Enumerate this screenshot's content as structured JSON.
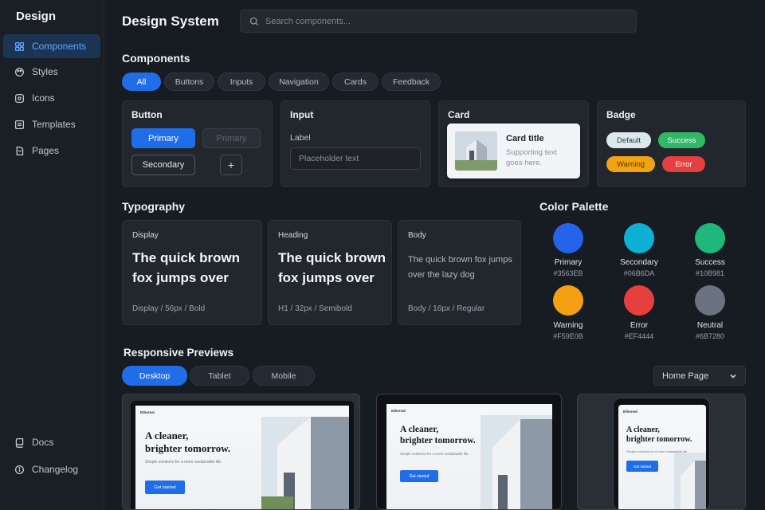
{
  "sidebar": {
    "brand": "Design",
    "items": [
      {
        "label": "Components",
        "icon": "components-icon"
      },
      {
        "label": "Styles",
        "icon": "palette-icon"
      },
      {
        "label": "Icons",
        "icon": "icons-icon"
      },
      {
        "label": "Templates",
        "icon": "templates-icon"
      },
      {
        "label": "Pages",
        "icon": "pages-icon"
      }
    ],
    "footer": [
      {
        "label": "Docs",
        "icon": "docs-icon"
      },
      {
        "label": "Changelog",
        "icon": "info-icon"
      }
    ]
  },
  "header": {
    "title": "Design System",
    "search_placeholder": "Search components..."
  },
  "components": {
    "heading": "Components",
    "filters": [
      "All",
      "Buttons",
      "Inputs",
      "Navigation",
      "Cards",
      "Feedback"
    ],
    "button_card": {
      "title": "Button",
      "primary": "Primary",
      "primary_disabled": "Primary",
      "secondary": "Secondary",
      "icon_button": "+"
    },
    "input_card": {
      "title": "Input",
      "label": "Label",
      "placeholder": "Placeholder text"
    },
    "card_card": {
      "title": "Card",
      "card_title": "Card title",
      "card_text": "Supporting text goes here."
    },
    "badge_card": {
      "title": "Badge",
      "badges": [
        {
          "label": "Default",
          "bg": "#dbe8ec",
          "fg": "#2a3a44"
        },
        {
          "label": "Success",
          "bg": "#2fb865",
          "fg": "#ffffff"
        },
        {
          "label": "Warning",
          "bg": "#f2a314",
          "fg": "#5a3a00"
        },
        {
          "label": "Error",
          "bg": "#e5403f",
          "fg": "#ffffff"
        }
      ]
    }
  },
  "typography": {
    "heading": "Typography",
    "samples": [
      {
        "label": "Display",
        "text": "The quick brown fox jumps over",
        "meta": "Display / 56px / Bold"
      },
      {
        "label": "Heading",
        "text": "The quick brown fox jumps over",
        "meta": "H1 / 32px / Semibold"
      },
      {
        "label": "Body",
        "text": "The quick brown fox jumps over the lazy dog",
        "meta": "Body / 16px / Regular"
      }
    ]
  },
  "palette": {
    "heading": "Color Palette",
    "colors": [
      {
        "name": "Primary",
        "hex": "#3563EB",
        "color": "#2563eb"
      },
      {
        "name": "Secondary",
        "hex": "#06B6DA",
        "color": "#0fb0d6"
      },
      {
        "name": "Success",
        "hex": "#10B981",
        "color": "#1fb87a"
      },
      {
        "name": "Warning",
        "hex": "#F59E0B",
        "color": "#f5a012"
      },
      {
        "name": "Error",
        "hex": "#EF4444",
        "color": "#e5403f"
      },
      {
        "name": "Neutral",
        "hex": "#6B7280",
        "color": "#6b7280"
      }
    ]
  },
  "previews": {
    "heading": "Responsive Previews",
    "tabs": [
      "Desktop",
      "Tablet",
      "Mobile"
    ],
    "page_select": "Home Page",
    "hero_line1": "A cleaner,",
    "hero_line2": "brighter tomorrow.",
    "hero_sub": "Simple solutions for a more sustainable life.",
    "cta": "Get started",
    "site_logo": "Ethereal"
  }
}
